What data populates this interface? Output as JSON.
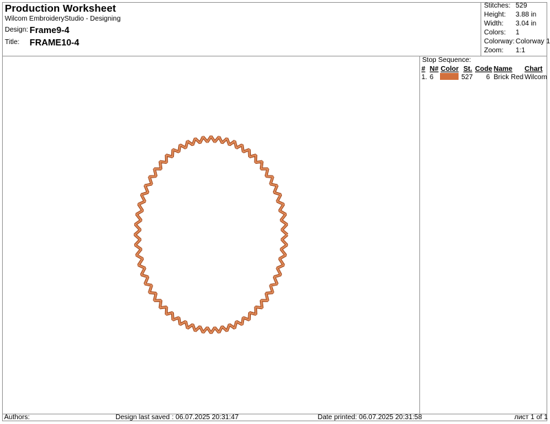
{
  "header": {
    "title": "Production Worksheet",
    "subtitle": "Wilcom EmbroideryStudio - Designing",
    "design_label": "Design:",
    "design_value": "Frame9-4",
    "title_label": "Title:",
    "title_value": "FRAME10-4"
  },
  "info": [
    {
      "key": "Stitches:",
      "value": "529"
    },
    {
      "key": "Height:",
      "value": "3.88 in"
    },
    {
      "key": "Width:",
      "value": "3.04 in"
    },
    {
      "key": "Colors:",
      "value": "1"
    },
    {
      "key": "Colorway:",
      "value": "Colorway 1"
    },
    {
      "key": "Zoom:",
      "value": "1:1"
    }
  ],
  "stop_sequence": {
    "title": "Stop Sequence:",
    "headers": {
      "num": "#",
      "n": "N#",
      "color": "Color",
      "st": "St.",
      "code": "Code",
      "name": "Name",
      "chart": "Chart"
    },
    "rows": [
      {
        "num": "1.",
        "n": "6",
        "color": "#d2703c",
        "st": "527",
        "code": "6",
        "name": "Brick Red",
        "chart": "Wilcom"
      }
    ]
  },
  "design": {
    "thread_color": "#d2703c",
    "thread_shadow": "#9c4a22",
    "thread_light": "#f0b48a"
  },
  "footer": {
    "authors": "Authors:",
    "saved": "Design last saved : 06.07.2025 20:31:47",
    "printed": "Date printed: 06.07.2025 20:31:58",
    "page": "лист 1 of 1"
  }
}
